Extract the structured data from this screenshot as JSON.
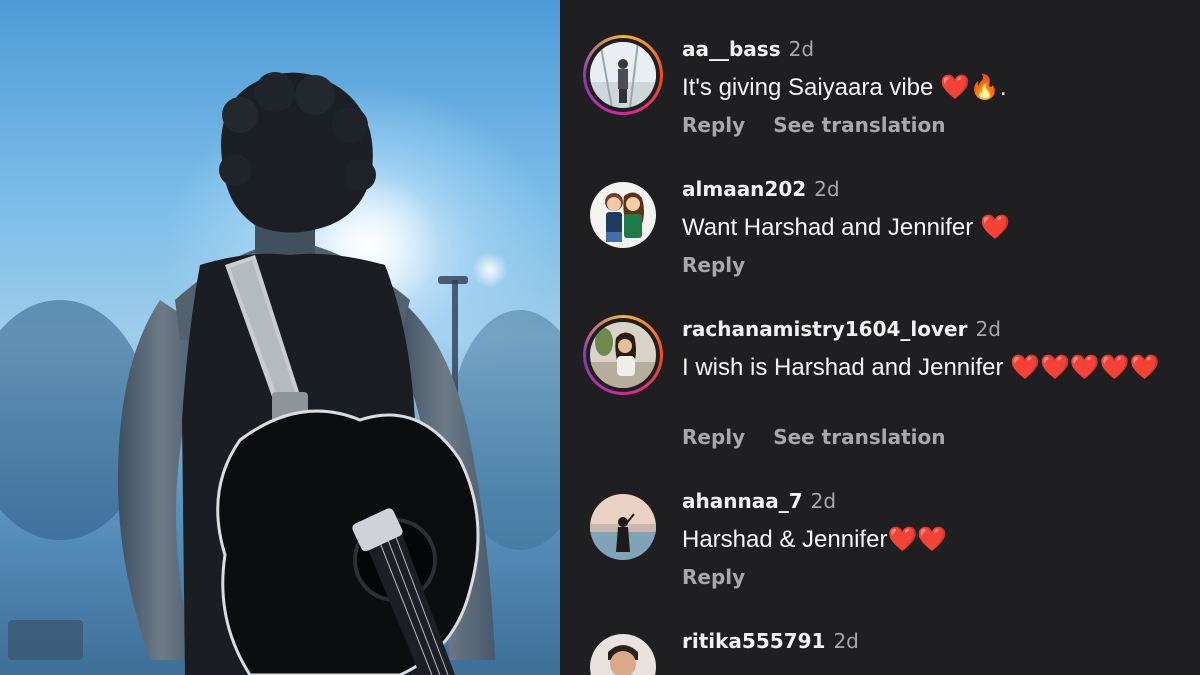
{
  "comments": [
    {
      "username": "aa__bass",
      "time": "2d",
      "text": "It's giving Saiyaara vibe ❤️🔥.",
      "actions": [
        "Reply",
        "See translation"
      ],
      "has_story": true
    },
    {
      "username": "almaan202",
      "time": "2d",
      "text": "Want Harshad and Jennifer ❤️",
      "actions": [
        "Reply"
      ],
      "has_story": false
    },
    {
      "username": "rachanamistry1604_lover",
      "time": "2d",
      "text": "I wish is Harshad and Jennifer ❤️❤️❤️❤️❤️",
      "actions": [
        "Reply",
        "See translation"
      ],
      "has_story": true
    },
    {
      "username": "ahannaa_7",
      "time": "2d",
      "text": "Harshad & Jennifer❤️❤️",
      "actions": [
        "Reply"
      ],
      "has_story": false
    },
    {
      "username": "ritika555791",
      "time": "2d",
      "text": "",
      "actions": [],
      "has_story": false
    }
  ],
  "colors": {
    "background": "#1f1f21",
    "username": "#f2f2f2",
    "secondary": "#a8a8a8",
    "story_ring": "#d6249f"
  }
}
